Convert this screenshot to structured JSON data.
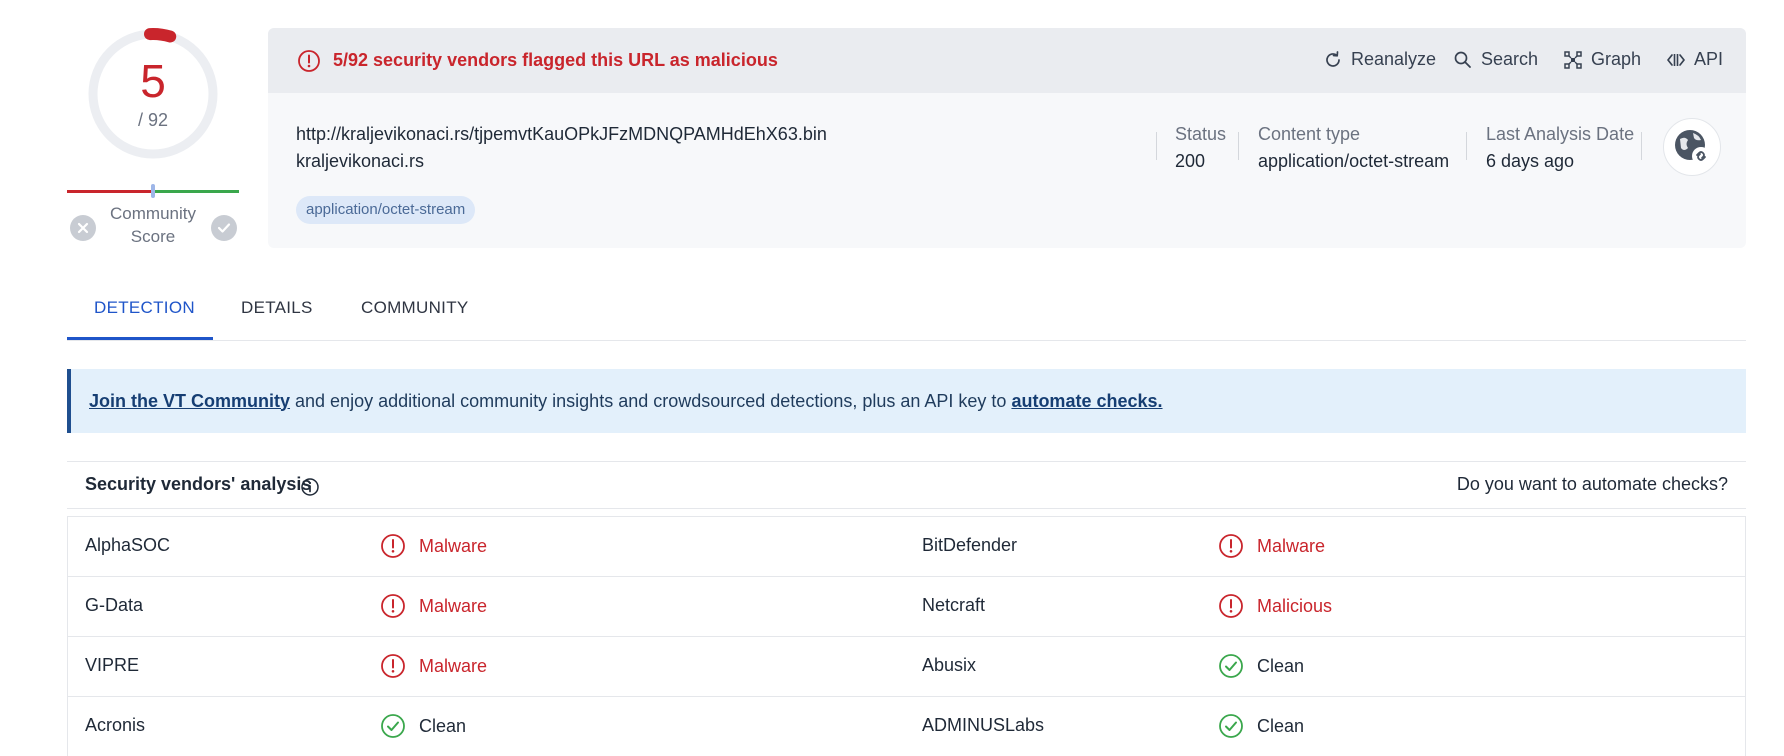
{
  "score": {
    "detections": "5",
    "total": "/ 92",
    "detection_ratio": 0.0543
  },
  "community": {
    "label": "Community Score"
  },
  "alert": {
    "text": "5/92 security vendors flagged this URL as malicious"
  },
  "actions": {
    "reanalyze": "Reanalyze",
    "search": "Search",
    "graph": "Graph",
    "api": "API"
  },
  "target": {
    "url": "http://kraljevikonaci.rs/tjpemvtKauOPkJFzMDNQPAMHdEhX63.bin",
    "domain": "kraljevikonaci.rs",
    "tag": "application/octet-stream"
  },
  "meta": {
    "status_label": "Status",
    "status_value": "200",
    "content_type_label": "Content type",
    "content_type_value": "application/octet-stream",
    "last_analysis_label": "Last Analysis Date",
    "last_analysis_value": "6 days ago"
  },
  "tabs": {
    "detection": "DETECTION",
    "details": "DETAILS",
    "community": "COMMUNITY"
  },
  "banner": {
    "link1": "Join the VT Community",
    "middle": " and enjoy additional community insights and crowdsourced detections, plus an API key to ",
    "link2": "automate checks."
  },
  "vendors": {
    "title": "Security vendors' analysis",
    "automate": "Do you want to automate checks?",
    "rows": [
      {
        "left_name": "AlphaSOC",
        "left_result": "Malware",
        "left_status": "malicious",
        "right_name": "BitDefender",
        "right_result": "Malware",
        "right_status": "malicious"
      },
      {
        "left_name": "G-Data",
        "left_result": "Malware",
        "left_status": "malicious",
        "right_name": "Netcraft",
        "right_result": "Malicious",
        "right_status": "malicious"
      },
      {
        "left_name": "VIPRE",
        "left_result": "Malware",
        "left_status": "malicious",
        "right_name": "Abusix",
        "right_result": "Clean",
        "right_status": "clean"
      },
      {
        "left_name": "Acronis",
        "left_result": "Clean",
        "left_status": "clean",
        "right_name": "ADMINUSLabs",
        "right_result": "Clean",
        "right_status": "clean"
      }
    ]
  },
  "icons": {
    "alert": "alert-circle-icon",
    "reanalyze": "refresh-icon",
    "search": "search-icon",
    "graph": "graph-icon",
    "api": "api-icon",
    "globe": "globe-link-icon",
    "info": "info-icon",
    "malicious": "alert-circle-icon",
    "clean": "check-circle-icon"
  },
  "colors": {
    "danger": "#c9252c",
    "clean": "#3aa74c",
    "accent": "#1f55c9",
    "banner_bg": "#e3f0fb"
  }
}
